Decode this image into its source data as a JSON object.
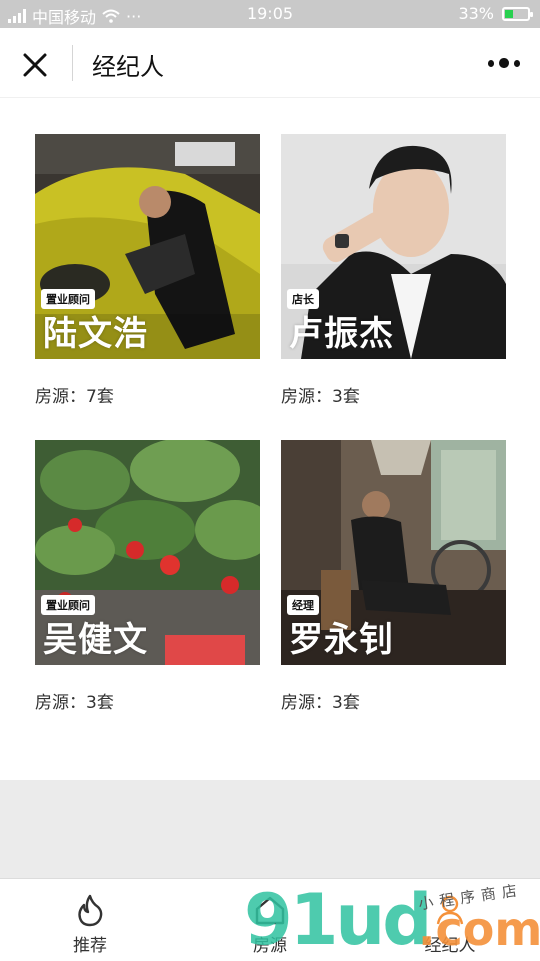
{
  "status_bar": {
    "carrier": "中国移动",
    "dots": "···",
    "time": "19:05",
    "battery_percent": "33%",
    "battery_level": 0.33,
    "battery_color": "#28d04f"
  },
  "navbar": {
    "title": "经纪人",
    "close_icon": "close-icon",
    "more_icon": "more-dots-icon"
  },
  "agents": [
    {
      "role": "置业顾问",
      "name": "陆文浩",
      "listings": "房源：7套"
    },
    {
      "role": "店长",
      "name": "卢振杰",
      "listings": "房源：3套"
    },
    {
      "role": "置业顾问",
      "name": "吴健文",
      "listings": "房源：3套"
    },
    {
      "role": "经理",
      "name": "罗永钊",
      "listings": "房源：3套"
    }
  ],
  "tabbar": {
    "tabs": [
      {
        "label": "推荐",
        "icon": "flame-icon"
      },
      {
        "label": "房源",
        "icon": "house-icon"
      },
      {
        "label": "经纪人",
        "icon": "person-icon"
      }
    ]
  },
  "watermark": {
    "big": "91ud",
    "dotcom": ".com",
    "small": "小程序商店"
  }
}
